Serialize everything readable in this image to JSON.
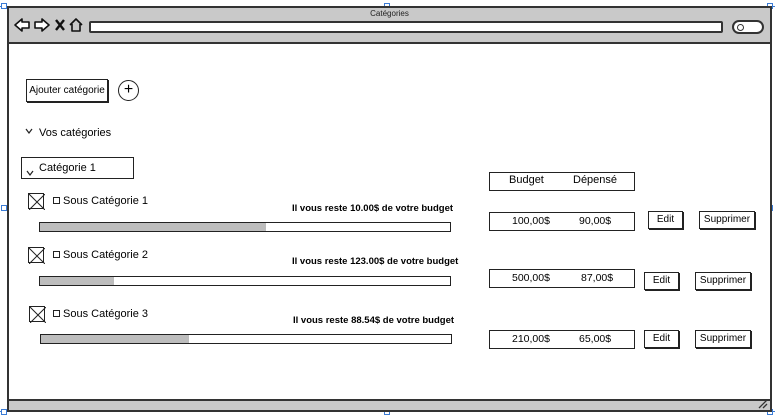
{
  "window": {
    "title": "Catégories"
  },
  "toolbar": {
    "add_category_label": "Ajouter catégorie",
    "add_icon": "+"
  },
  "section": {
    "label": "Vos catégories"
  },
  "category": {
    "name": "Catégorie 1"
  },
  "columns": {
    "budget": "Budget",
    "spent": "Dépensé"
  },
  "actions": {
    "edit": "Edit",
    "delete": "Supprimer"
  },
  "subcategories": [
    {
      "name": "Sous Catégorie 1",
      "message": "Il vous reste 10.00$ de votre budget",
      "budget": "100,00$",
      "spent": "90,00$",
      "progress": 0.55
    },
    {
      "name": "Sous Catégorie 2",
      "message": "Il vous reste 123.00$ de votre budget",
      "budget": "500,00$",
      "spent": "87,00$",
      "progress": 0.18
    },
    {
      "name": "Sous Catégorie 3",
      "message": "Il vous reste 88.54$ de votre budget",
      "budget": "210,00$",
      "spent": "65,00$",
      "progress": 0.36
    }
  ]
}
